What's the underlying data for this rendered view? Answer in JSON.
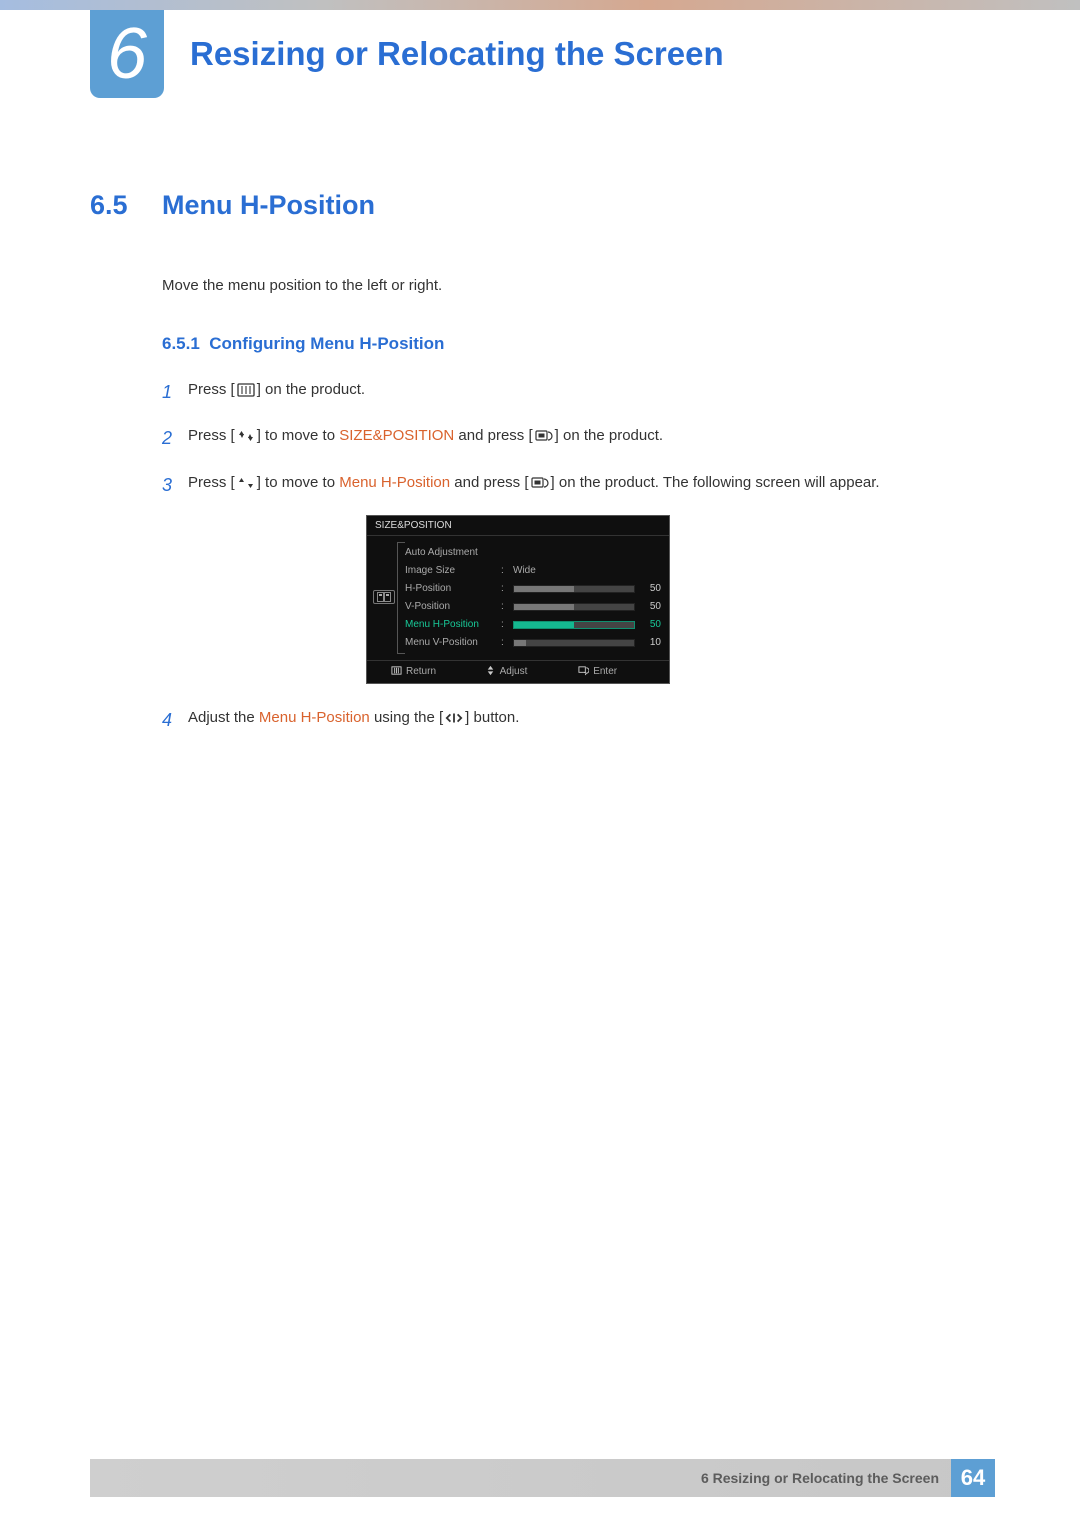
{
  "chapter": {
    "number": "6",
    "title": "Resizing or Relocating the Screen"
  },
  "section": {
    "number": "6.5",
    "title": "Menu H-Position",
    "description": "Move the menu position to the left or right."
  },
  "subsection": {
    "number": "6.5.1",
    "title": "Configuring Menu H-Position"
  },
  "steps": {
    "s1": {
      "num": "1",
      "a": "Press [",
      "b": "] on the product."
    },
    "s2": {
      "num": "2",
      "a": "Press [",
      "b": "] to move to ",
      "c": "SIZE&POSITION",
      "d": " and press [",
      "e": "] on the product."
    },
    "s3": {
      "num": "3",
      "a": "Press [",
      "b": "] to move to ",
      "c": "Menu H-Position",
      "d": " and press [",
      "e": "] on the product. The following screen will appear."
    },
    "s4": {
      "num": "4",
      "a": "Adjust the ",
      "b": "Menu H-Position",
      "c": " using the [",
      "d": "] button."
    }
  },
  "osd": {
    "title": "SIZE&POSITION",
    "rows": {
      "auto": {
        "label": "Auto Adjustment",
        "value": ""
      },
      "size": {
        "label": "Image Size",
        "value": "Wide"
      },
      "hpos": {
        "label": "H-Position",
        "num": "50",
        "pct": 50
      },
      "vpos": {
        "label": "V-Position",
        "num": "50",
        "pct": 50
      },
      "mhpos": {
        "label": "Menu H-Position",
        "num": "50",
        "pct": 50
      },
      "mvpos": {
        "label": "Menu V-Position",
        "num": "10",
        "pct": 10
      }
    },
    "footer": {
      "return": "Return",
      "adjust": "Adjust",
      "enter": "Enter"
    }
  },
  "footer": {
    "text": "6 Resizing or Relocating the Screen",
    "page": "64"
  }
}
